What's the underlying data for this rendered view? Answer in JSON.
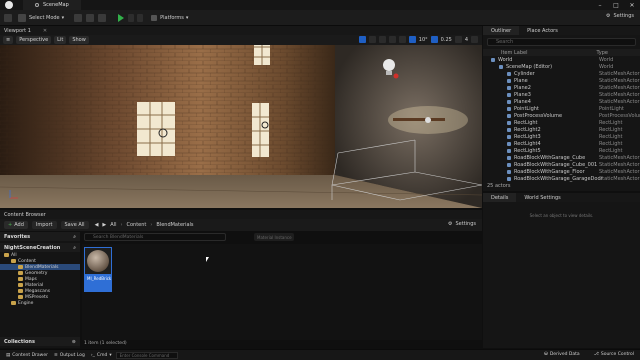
{
  "app": {
    "map_tab": "SceneMap"
  },
  "toolbar": {
    "select_mode": "Select Mode",
    "platforms": "Platforms",
    "settings": "Settings"
  },
  "viewport": {
    "tab_title": "Viewport 1",
    "perspective": "Perspective",
    "lit": "Lit",
    "show": "Show",
    "angle_value": "10°",
    "scale_value": "0.25",
    "camera_speed": "4"
  },
  "outliner": {
    "tab_outliner": "Outliner",
    "tab_place_actors": "Place Actors",
    "search_placeholder": "Search",
    "col_item_label": "Item Label",
    "col_type": "Type",
    "rows": [
      {
        "label": "World",
        "type": "World",
        "indent": 0
      },
      {
        "label": "SceneMap (Editor)",
        "type": "World",
        "indent": 1
      },
      {
        "label": "Cylinder",
        "type": "StaticMeshActor",
        "indent": 2
      },
      {
        "label": "Plane",
        "type": "StaticMeshActor",
        "indent": 2
      },
      {
        "label": "Plane2",
        "type": "StaticMeshActor",
        "indent": 2
      },
      {
        "label": "Plane3",
        "type": "StaticMeshActor",
        "indent": 2
      },
      {
        "label": "Plane4",
        "type": "StaticMeshActor",
        "indent": 2
      },
      {
        "label": "PointLight",
        "type": "PointLight",
        "indent": 2
      },
      {
        "label": "PostProcessVolume",
        "type": "PostProcessVolume",
        "indent": 2
      },
      {
        "label": "RectLight",
        "type": "RectLight",
        "indent": 2
      },
      {
        "label": "RectLight2",
        "type": "RectLight",
        "indent": 2
      },
      {
        "label": "RectLight3",
        "type": "RectLight",
        "indent": 2
      },
      {
        "label": "RectLight4",
        "type": "RectLight",
        "indent": 2
      },
      {
        "label": "RectLight5",
        "type": "RectLight",
        "indent": 2
      },
      {
        "label": "RoadBlockWithGarage_Cube",
        "type": "StaticMeshActor",
        "indent": 2
      },
      {
        "label": "RoadBlockWithGarage_Cube_001",
        "type": "StaticMeshActor",
        "indent": 2
      },
      {
        "label": "RoadBlockWithGarage_Floor",
        "type": "StaticMeshActor",
        "indent": 2
      },
      {
        "label": "RoadBlockWithGarage_GarageDoor",
        "type": "StaticMeshActor",
        "indent": 2
      }
    ],
    "count": "25 actors"
  },
  "details": {
    "tab_details": "Details",
    "tab_world_settings": "World Settings",
    "empty_message": "Select an object to view details."
  },
  "content_browser": {
    "tab": "Content Browser",
    "add": "Add",
    "import": "Import",
    "save_all": "Save All",
    "crumbs": [
      "All",
      "Content",
      "BlendMaterials"
    ],
    "settings": "Settings",
    "favorites": "Favorites",
    "project": "NightSceneCreation",
    "tree": [
      {
        "label": "All",
        "indent": 0,
        "selected": false
      },
      {
        "label": "Content",
        "indent": 1,
        "selected": false
      },
      {
        "label": "BlendMaterials",
        "indent": 2,
        "selected": true
      },
      {
        "label": "Geometry",
        "indent": 2,
        "selected": false
      },
      {
        "label": "Maps",
        "indent": 2,
        "selected": false
      },
      {
        "label": "Material",
        "indent": 2,
        "selected": false
      },
      {
        "label": "Megascans",
        "indent": 2,
        "selected": false
      },
      {
        "label": "MSPresets",
        "indent": 2,
        "selected": false
      },
      {
        "label": "Engine",
        "indent": 1,
        "selected": false
      }
    ],
    "collections": "Collections",
    "search_placeholder": "Search BlendMaterials",
    "filter_placeholder": "Material Instance",
    "asset_label": "MI_RedBrick",
    "status": "1 item (1 selected)"
  },
  "statusbar": {
    "content_drawer": "Content Drawer",
    "output_log": "Output Log",
    "cmd": "Cmd",
    "cmd_placeholder": "Enter Console Command",
    "derived_data": "Derived Data",
    "source_control": "Source Control"
  },
  "colors": {
    "accent": "#2f6fd6",
    "play": "#32b04a",
    "folder": "#c9a34b"
  }
}
